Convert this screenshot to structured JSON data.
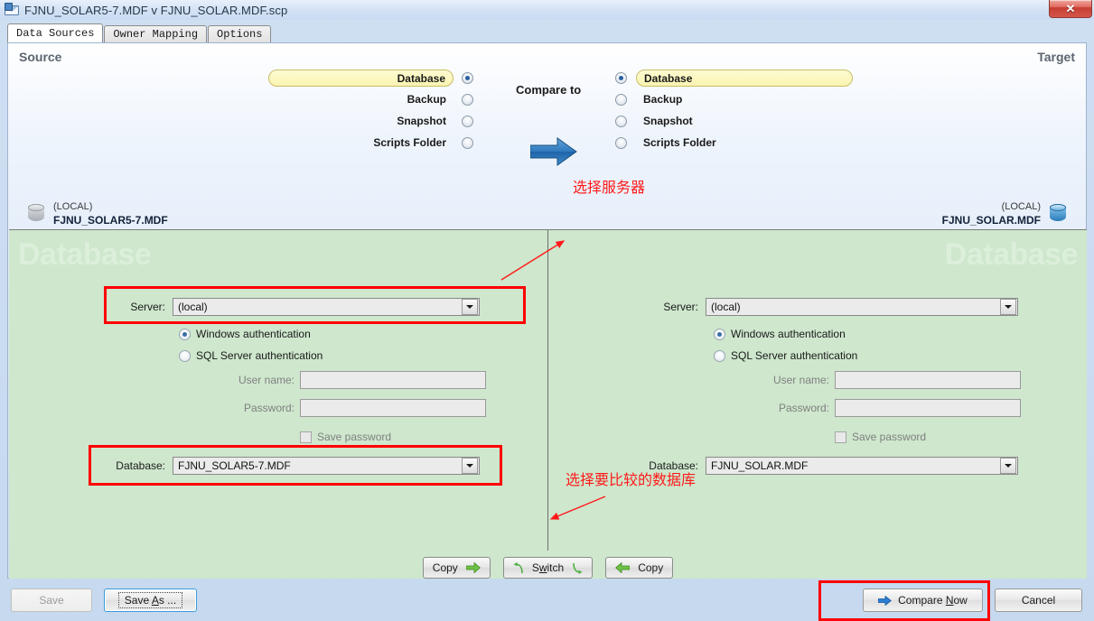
{
  "window": {
    "title": "FJNU_SOLAR5-7.MDF v FJNU_SOLAR.MDF.scp",
    "app_icon": "compare-documents-icon",
    "close_label": "✕"
  },
  "tabs": [
    {
      "label": "Data Sources",
      "active": true
    },
    {
      "label": "Owner Mapping",
      "active": false
    },
    {
      "label": "Options",
      "active": false
    }
  ],
  "headers": {
    "source": "Source",
    "target": "Target",
    "compare_to": "Compare to"
  },
  "source_selector": {
    "options": [
      "Database",
      "Backup",
      "Snapshot",
      "Scripts Folder"
    ],
    "selected": "Database"
  },
  "target_selector": {
    "options": [
      "Database",
      "Backup",
      "Snapshot",
      "Scripts Folder"
    ],
    "selected": "Database"
  },
  "source_db_head": {
    "server": "(LOCAL)",
    "database": "FJNU_SOLAR5-7.MDF",
    "icon": "database-cylinder-icon"
  },
  "target_db_head": {
    "server": "(LOCAL)",
    "database": "FJNU_SOLAR.MDF",
    "icon": "database-cylinder-icon"
  },
  "watermark": {
    "source": "Database",
    "target": "Database"
  },
  "source_form": {
    "server_label": "Server:",
    "server_value": "(local)",
    "windows_auth_label": "Windows authentication",
    "windows_auth_selected": true,
    "sql_auth_label": "SQL Server authentication",
    "sql_auth_selected": false,
    "username_label": "User name:",
    "username_value": "",
    "password_label": "Password:",
    "password_value": "",
    "save_password_label": "Save password",
    "save_password_checked": false,
    "database_label": "Database:",
    "database_value": "FJNU_SOLAR5-7.MDF"
  },
  "target_form": {
    "server_label": "Server:",
    "server_value": "(local)",
    "windows_auth_label": "Windows authentication",
    "windows_auth_selected": true,
    "sql_auth_label": "SQL Server authentication",
    "sql_auth_selected": false,
    "username_label": "User name:",
    "username_value": "",
    "password_label": "Password:",
    "password_value": "",
    "save_password_label": "Save password",
    "save_password_checked": false,
    "database_label": "Database:",
    "database_value": "FJNU_SOLAR.MDF"
  },
  "annotations": {
    "select_server": "选择服务器",
    "select_database": "选择要比较的数据库",
    "color": "#ff1a1a"
  },
  "middle_buttons": {
    "copy_right_label": "Copy",
    "switch_label": "Switch",
    "copy_left_label": "Copy"
  },
  "bottom_buttons": {
    "save_label": "Save",
    "save_as_label": "Save As ...",
    "compare_now_label": "Compare Now",
    "cancel_label": "Cancel"
  },
  "colors": {
    "accent_blue": "#2a6cb5",
    "green_panel": "#cee7cd",
    "highlight_yellow": "#faf4b0",
    "annotation_red": "#ff0000"
  }
}
